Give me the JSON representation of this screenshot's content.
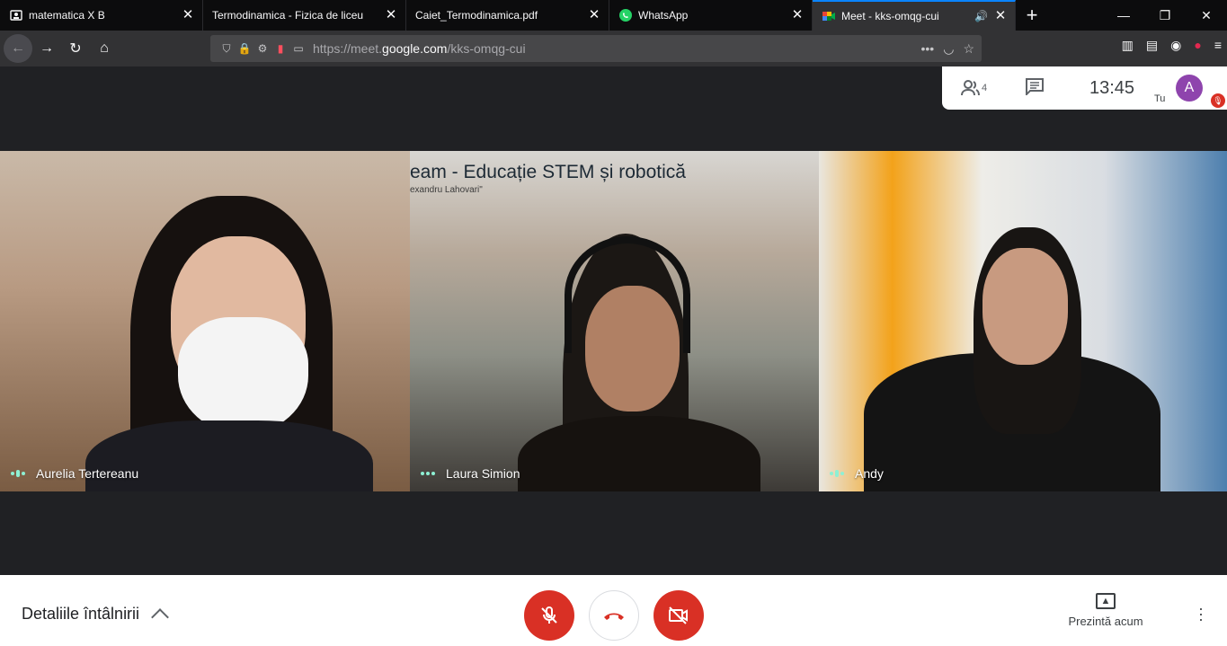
{
  "browser": {
    "tabs": [
      {
        "title": "matematica X B",
        "icon": "person-icon"
      },
      {
        "title": "Termodinamica - Fizica de liceu",
        "icon": "page-icon"
      },
      {
        "title": "Caiet_Termodinamica.pdf",
        "icon": "pdf-icon"
      },
      {
        "title": "WhatsApp",
        "icon": "whatsapp-icon"
      },
      {
        "title": "Meet - kks-omqg-cui",
        "icon": "meet-icon",
        "active": true
      }
    ],
    "new_tab": "+",
    "url_prefix": "https://meet.",
    "url_domain": "google.com",
    "url_path": "/kks-omqg-cui"
  },
  "meet": {
    "participants_count": "4",
    "clock": "13:45",
    "self_avatar_letter": "A",
    "self_label": "Tu",
    "participants": [
      {
        "name": "Aurelia Tertereanu"
      },
      {
        "name": "Laura Simion"
      },
      {
        "name": "Andy"
      }
    ],
    "banner_text": "eam - Educație STEM și robotică",
    "banner_subtext": "exandru Lahovari\"",
    "details_label": "Detaliile întâlnirii",
    "present_label": "Prezintă acum",
    "accent_red": "#d93025",
    "speaking_color": "#8ef0d4"
  }
}
